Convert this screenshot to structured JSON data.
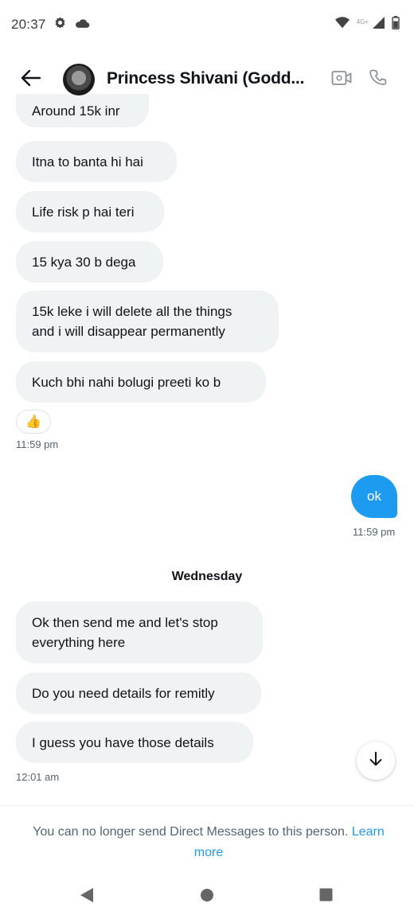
{
  "status_bar": {
    "time": "20:37",
    "network_label": "4G+"
  },
  "header": {
    "contact_name": "Princess Shivani (Godd...",
    "icons": [
      "back-arrow-icon",
      "video-call-icon",
      "phone-icon"
    ]
  },
  "messages": [
    {
      "text": "Around 15k inr"
    },
    {
      "text": "Itna to banta hi hai"
    },
    {
      "text": "Life risk p hai teri"
    },
    {
      "text": "15 kya 30 b dega"
    },
    {
      "text": "15k leke i will delete all the things\nand i will disappear permanently"
    },
    {
      "text": "Kuch bhi nahi bolugi preeti ko b"
    }
  ],
  "reaction": {
    "emoji": "👍"
  },
  "time_1": "11:59 pm",
  "sent_message": {
    "text": "ok",
    "time": "11:59 pm"
  },
  "day_separator": "Wednesday",
  "messages_2": [
    {
      "text": "Ok then send me and let's stop\neverything here"
    },
    {
      "text": "Do you need details for remitly"
    },
    {
      "text": "I guess you have those details"
    }
  ],
  "time_2": "12:01 am",
  "notice": {
    "text": "You can no longer send Direct Messages to this person.",
    "link": "Learn more"
  },
  "colors": {
    "accent": "#1d9bf0",
    "bubble_received": "#eff3f4",
    "text_primary": "#0f1419",
    "text_secondary": "#536471"
  }
}
